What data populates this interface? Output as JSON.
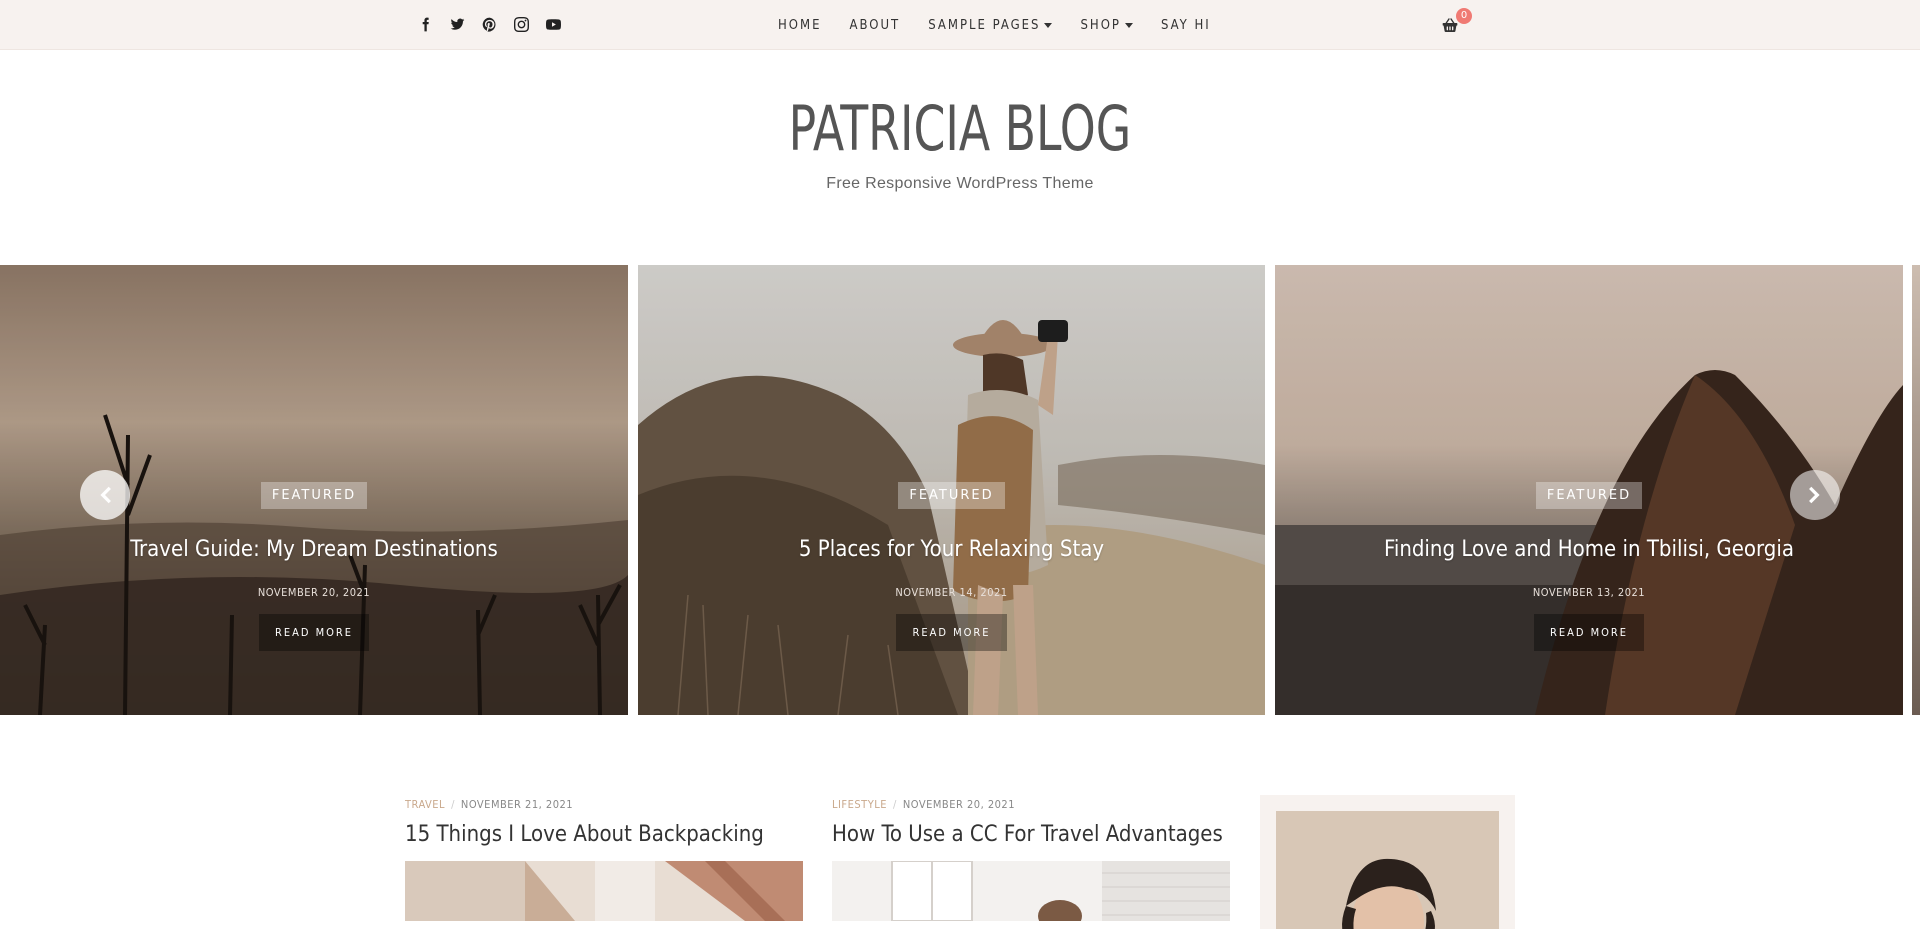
{
  "topbar": {
    "social": [
      "facebook-icon",
      "twitter-icon",
      "pinterest-icon",
      "instagram-icon",
      "youtube-icon"
    ],
    "nav": [
      {
        "label": "HOME",
        "dropdown": false
      },
      {
        "label": "ABOUT",
        "dropdown": false
      },
      {
        "label": "SAMPLE PAGES",
        "dropdown": true
      },
      {
        "label": "SHOP",
        "dropdown": true
      },
      {
        "label": "SAY HI",
        "dropdown": false
      }
    ],
    "cart": {
      "icon": "basket-icon",
      "count": "0"
    }
  },
  "brand": {
    "title": "PATRICIA BLOG",
    "tagline": "Free Responsive WordPress Theme"
  },
  "slider": {
    "slides": [
      {
        "badge": "FEATURED",
        "title": "Travel Guide: My Dream Destinations",
        "date": "NOVEMBER 20, 2021",
        "cta": "READ MORE"
      },
      {
        "badge": "FEATURED",
        "title": "5 Places for Your Relaxing Stay",
        "date": "NOVEMBER 14, 2021",
        "cta": "READ MORE"
      },
      {
        "badge": "FEATURED",
        "title": "Finding Love and Home in Tbilisi, Georgia",
        "date": "NOVEMBER 13, 2021",
        "cta": "READ MORE"
      }
    ]
  },
  "posts": [
    {
      "category": "TRAVEL",
      "date": "NOVEMBER 21, 2021",
      "title": "15 Things I Love About Backpacking"
    },
    {
      "category": "LIFESTYLE",
      "date": "NOVEMBER 20, 2021",
      "title": "How To Use a CC For Travel Advantages"
    }
  ],
  "colors": {
    "topbar_bg": "#f7f2ef",
    "accent": "#c9a88c",
    "badge": "#f07a73"
  }
}
